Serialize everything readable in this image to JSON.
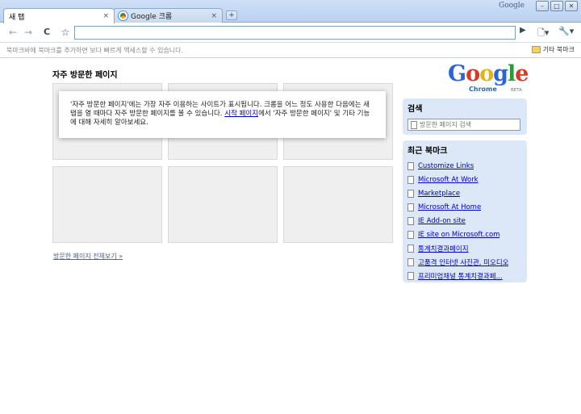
{
  "window": {
    "brand": "Google",
    "minimize": "–",
    "maximize": "□",
    "close": "✕"
  },
  "tabs": [
    {
      "label": "새 탭",
      "close": "×"
    },
    {
      "label": "Google 크롬",
      "close": "×"
    }
  ],
  "new_tab": "+",
  "toolbar": {
    "back": "←",
    "forward": "→",
    "reload": "C",
    "star": "☆",
    "url": "",
    "go": "▶",
    "page_menu": "🗋▾",
    "wrench_menu": "🔧▾"
  },
  "bookmark_bar": {
    "hint": "북마크바에 북마크를 추가하면 보다 빠르게 액세스할 수 있습니다.",
    "other_bookmarks": "기타 북마크"
  },
  "most_visited": {
    "title": "자주 방문한 페이지",
    "popup_text_1": "'자주 방문한 페이지'에는 가장 자주 이용하는 사이트가 표시됩니다. 크롬을 어느 정도 사용한 다음에는 새 탭을 열 때마다 자주 방문한 페이지를 볼 수 있습니다. ",
    "popup_link": "시작 페이지",
    "popup_text_2": "에서 '자주 방문한 페이지' 및 기타 기능에 대해 자세히 알아보세요.",
    "show_all": "방문한 페이지 전체보기 »"
  },
  "logo": {
    "wordmark": "Google",
    "product": "Chrome",
    "badge": "BETA"
  },
  "search": {
    "title": "검색",
    "placeholder": "방문한 페이지 검색"
  },
  "recent_bookmarks": {
    "title": "최근 북마크",
    "items": [
      "Customize Links",
      "Microsoft At Work",
      "Marketplace",
      "Microsoft At Home",
      "IE Add-on site",
      "IE site on Microsoft.com",
      "통계치결과페이지",
      "고품격 인터넷 사진관, 미오디오",
      "프리미엄채널 통계치결과페..."
    ]
  }
}
